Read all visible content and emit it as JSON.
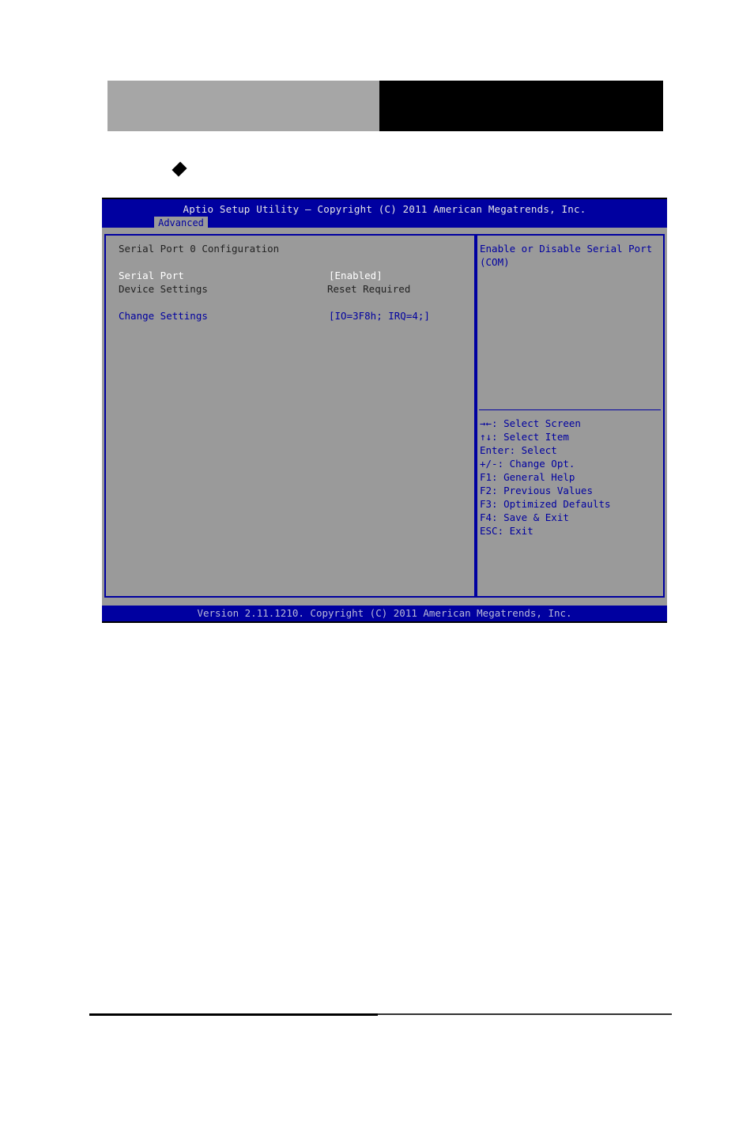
{
  "page_header": {
    "left_block_color": "#a6a6a6",
    "right_block_color": "#000000",
    "bullet_icon": "diamond"
  },
  "bios": {
    "title": "Aptio Setup Utility – Copyright (C) 2011 American Megatrends, Inc.",
    "active_tab": "Advanced",
    "section_title": "Serial Port 0 Configuration",
    "settings": [
      {
        "label": "Serial Port",
        "value": "[Enabled]",
        "state": "selected"
      },
      {
        "label": "Device Settings",
        "value": "Reset Required",
        "state": "readonly"
      },
      {
        "label": "Change Settings",
        "value": "[IO=3F8h; IRQ=4;]",
        "state": "option"
      }
    ],
    "help_text": [
      "Enable or Disable Serial Port",
      "(COM)"
    ],
    "key_help": [
      "→←: Select Screen",
      "↑↓: Select Item",
      "Enter: Select",
      "+/-: Change Opt.",
      "F1: General Help",
      "F2: Previous Values",
      "F3: Optimized Defaults",
      "F4: Save & Exit",
      "ESC: Exit"
    ],
    "footer": "Version 2.11.1210. Copyright (C) 2011 American Megatrends, Inc.",
    "colors": {
      "bar": "#0000a0",
      "panel": "#9a9a9a",
      "highlight": "#ffffff"
    }
  }
}
